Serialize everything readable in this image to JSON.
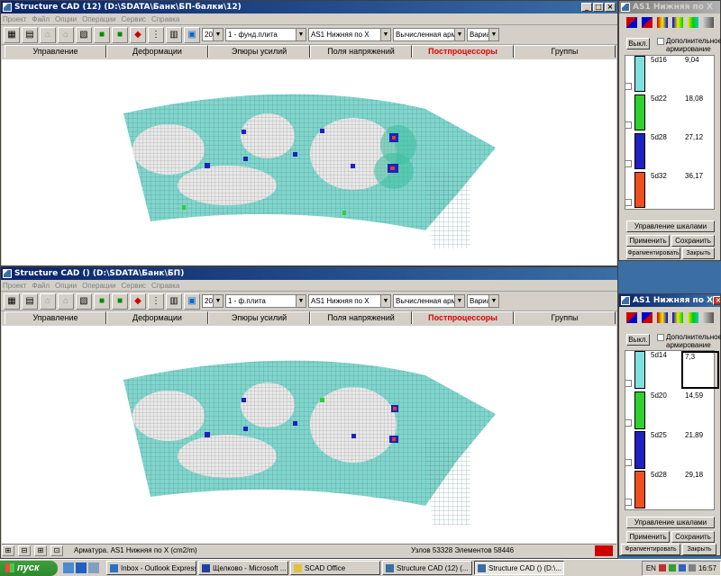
{
  "top_window": {
    "title": "Structure CAD (12) (D:\\SDATA\\Банк\\БП-балки\\12)",
    "menu": [
      "Проект",
      "Файл",
      "Опции",
      "Операции",
      "Сервис",
      "Справка"
    ],
    "combo_num": "20",
    "combo_plate": "1 - фунд.плита",
    "combo_result": "AS1 Нижняя по X",
    "combo_arm": "Вычисленная армату",
    "combo_var": "Вариан"
  },
  "bottom_window": {
    "title": "Structure CAD () (D:\\SDATA\\Банк\\БП)",
    "menu": [
      "Проект",
      "Файл",
      "Опции",
      "Операции",
      "Сервис",
      "Справка"
    ],
    "combo_num": "20",
    "combo_plate": "1 - ф.плита",
    "combo_result": "AS1 Нижняя по X",
    "combo_arm": "Вычисленная армату",
    "combo_var": "Вариан"
  },
  "tabs": [
    "Управление",
    "Деформации",
    "Эпюры усилий",
    "Поля напряжений",
    "Постпроцессоры",
    "Группы"
  ],
  "active_tab": "Постпроцессоры",
  "status": {
    "text": "Арматура. AS1 Нижняя по X (cm2/m)",
    "nodes": "Узлов 53328 Элементов 58446"
  },
  "panel_top": {
    "title": "AS1 Нижняя по X",
    "off_btn": "Выкл.",
    "extra_label": "Дополнительное армирование",
    "rows": [
      {
        "bar": "5d16",
        "value": "9,04",
        "color": "#80e0e0"
      },
      {
        "bar": "5d22",
        "value": "18,08",
        "color": "#30d030"
      },
      {
        "bar": "5d28",
        "value": "27,12",
        "color": "#2020c0"
      },
      {
        "bar": "5d32",
        "value": "36,17",
        "color": "#f05020"
      }
    ],
    "scale_btn": "Управление шкалами",
    "apply_btn": "Применить",
    "save_btn": "Сохранить",
    "frag_btn": "Фрагментировать",
    "close_btn": "Закрыть"
  },
  "panel_bottom": {
    "title": "AS1 Нижняя по X",
    "off_btn": "Выкл.",
    "extra_label": "Дополнительное армирование",
    "rows": [
      {
        "bar": "5d14",
        "value": "7,3",
        "color": "#80e0e0"
      },
      {
        "bar": "5d20",
        "value": "14,59",
        "color": "#30d030"
      },
      {
        "bar": "5d25",
        "value": "21,89",
        "color": "#2020c0"
      },
      {
        "bar": "5d28",
        "value": "29,18",
        "color": "#f05020"
      }
    ],
    "scale_btn": "Управление шкалами",
    "apply_btn": "Применить",
    "save_btn": "Сохранить",
    "frag_btn": "Фрагментировать",
    "close_btn": "Закрыть"
  },
  "taskbar": {
    "start": "пуск",
    "tasks": [
      "Inbox - Outlook Express",
      "Щелково - Microsoft ...",
      "SCAD Office",
      "Structure CAD (12) (...",
      "Structure CAD () (D:\\..."
    ],
    "lang": "EN",
    "clock": "16:57"
  }
}
